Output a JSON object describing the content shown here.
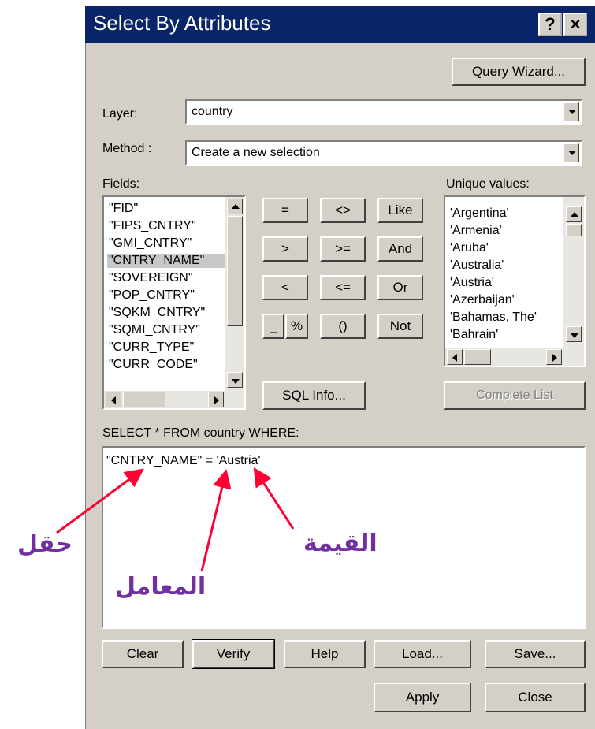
{
  "window": {
    "title": "Select By Attributes",
    "help_glyph": "?",
    "close_glyph": "×"
  },
  "buttons": {
    "query_wizard": "Query Wizard...",
    "sql_info": "SQL Info...",
    "complete_list": "Complete List",
    "clear": "Clear",
    "verify": "Verify",
    "help": "Help",
    "load": "Load...",
    "save": "Save...",
    "apply": "Apply",
    "close": "Close"
  },
  "layer": {
    "label": "Layer:",
    "value": "country"
  },
  "method": {
    "label": "Method :",
    "value": "Create a new selection"
  },
  "fields": {
    "label": "Fields:",
    "items": [
      "\"FID\"",
      "\"FIPS_CNTRY\"",
      "\"GMI_CNTRY\"",
      "\"CNTRY_NAME\"",
      "\"SOVEREIGN\"",
      "\"POP_CNTRY\"",
      "\"SQKM_CNTRY\"",
      "\"SQMI_CNTRY\"",
      "\"CURR_TYPE\"",
      "\"CURR_CODE\""
    ],
    "selected_index": 3
  },
  "operators": [
    "=",
    "<>",
    "Like",
    ">",
    ">=",
    "And",
    "<",
    "<=",
    "Or",
    "_",
    "%",
    "()",
    "Not"
  ],
  "unique_values": {
    "label": "Unique values:",
    "items": [
      "'Argentina'",
      "'Armenia'",
      "'Aruba'",
      "'Australia'",
      "'Austria'",
      "'Azerbaijan'",
      "'Bahamas, The'",
      "'Bahrain'"
    ]
  },
  "query": {
    "label": "SELECT * FROM country WHERE:",
    "expression": "\"CNTRY_NAME\" = 'Austria'"
  },
  "annotations": {
    "field": "حقل",
    "operator": "المعامل",
    "value": "القيمة",
    "color": "#7030a0",
    "arrow_color": "#ff0033"
  },
  "colors": {
    "titlebar": "#0a246a",
    "face": "#d4d0c8"
  }
}
